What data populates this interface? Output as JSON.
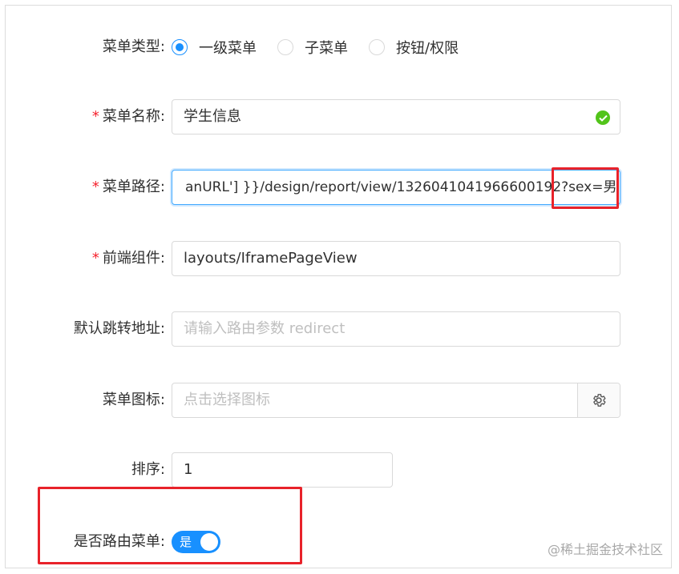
{
  "form": {
    "menu_type": {
      "label": "菜单类型:",
      "options": [
        "一级菜单",
        "子菜单",
        "按钮/权限"
      ],
      "selected": "一级菜单"
    },
    "menu_name": {
      "required_mark": "*",
      "label": "菜单名称:",
      "value": "学生信息"
    },
    "menu_path": {
      "required_mark": "*",
      "label": "菜单路径:",
      "value": "anURL'] }}/design/report/view/1326041041966600192?sex=男"
    },
    "frontend_component": {
      "required_mark": "*",
      "label": "前端组件:",
      "value": "layouts/IframePageView"
    },
    "default_redirect": {
      "label": "默认跳转地址:",
      "placeholder": "请输入路由参数 redirect"
    },
    "menu_icon": {
      "label": "菜单图标:",
      "placeholder": "点击选择图标"
    },
    "sort": {
      "label": "排序:",
      "value": "1"
    },
    "is_route": {
      "label": "是否路由菜单:",
      "switch_text": "是",
      "on": true
    }
  },
  "watermark": "@稀土掘金技术社区",
  "colors": {
    "primary": "#1890ff",
    "success": "#52c41a",
    "required": "#f5222d",
    "highlight": "#e8222a"
  },
  "icons": {
    "valid": "check-circle-icon",
    "settings": "gear-icon"
  }
}
